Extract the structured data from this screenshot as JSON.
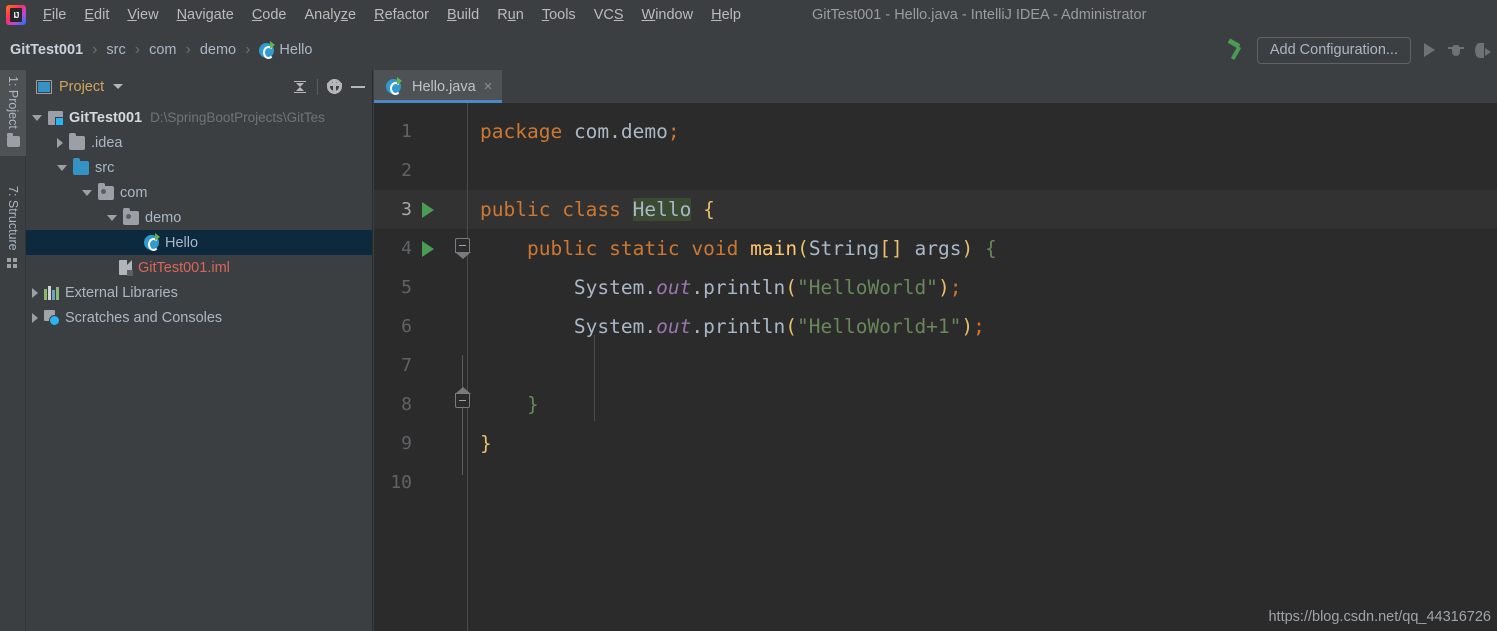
{
  "window": {
    "title": "GitTest001 - Hello.java - IntelliJ IDEA - Administrator",
    "logo_alt": "intellij-idea-logo"
  },
  "menubar": {
    "items": [
      {
        "label": "File",
        "mnemonic": "F"
      },
      {
        "label": "Edit",
        "mnemonic": "E"
      },
      {
        "label": "View",
        "mnemonic": "V"
      },
      {
        "label": "Navigate",
        "mnemonic": "N"
      },
      {
        "label": "Code",
        "mnemonic": "C"
      },
      {
        "label": "Analyze",
        "mnemonic": "z"
      },
      {
        "label": "Refactor",
        "mnemonic": "R"
      },
      {
        "label": "Build",
        "mnemonic": "B"
      },
      {
        "label": "Run",
        "mnemonic": "u"
      },
      {
        "label": "Tools",
        "mnemonic": "T"
      },
      {
        "label": "VCS",
        "mnemonic": "S"
      },
      {
        "label": "Window",
        "mnemonic": "W"
      },
      {
        "label": "Help",
        "mnemonic": "H"
      }
    ]
  },
  "navbar": {
    "breadcrumbs": [
      {
        "label": "GitTest001",
        "icon": null
      },
      {
        "label": "src",
        "icon": null
      },
      {
        "label": "com",
        "icon": null
      },
      {
        "label": "demo",
        "icon": null
      },
      {
        "label": "Hello",
        "icon": "java-class-icon"
      }
    ],
    "separator": "›",
    "build_icon": "hammer-icon",
    "add_configuration_label": "Add Configuration...",
    "run_icon": "run-icon",
    "debug_icon": "debug-icon",
    "coverage_icon": "run-with-coverage-icon"
  },
  "toolstrip": {
    "buttons": [
      {
        "label": "1: Project",
        "icon": "project-folder-icon",
        "active": true
      },
      {
        "label": "7: Structure",
        "icon": "structure-icon",
        "active": false
      }
    ]
  },
  "project_panel": {
    "title": "Project",
    "title_icon": "project-view-icon",
    "dropdown_icon": "chevron-down-icon",
    "actions": [
      {
        "name": "collapse-all-icon"
      },
      {
        "name": "settings-gear-icon"
      },
      {
        "name": "hide-panel-icon"
      }
    ],
    "tree": [
      {
        "label": "GitTest001",
        "suffix": "D:\\SpringBootProjects\\GitTes",
        "indent": 0,
        "twisty": "down",
        "icon": "module-icon",
        "style": "bold",
        "selected": false
      },
      {
        "label": ".idea",
        "suffix": "",
        "indent": 1,
        "twisty": "right",
        "icon": "folder-icon",
        "style": "normal",
        "selected": false
      },
      {
        "label": "src",
        "suffix": "",
        "indent": 1,
        "twisty": "down",
        "icon": "source-folder-icon",
        "style": "normal",
        "selected": false
      },
      {
        "label": "com",
        "suffix": "",
        "indent": 2,
        "twisty": "down",
        "icon": "package-icon",
        "style": "normal",
        "selected": false
      },
      {
        "label": "demo",
        "suffix": "",
        "indent": 3,
        "twisty": "down",
        "icon": "package-icon",
        "style": "normal",
        "selected": false
      },
      {
        "label": "Hello",
        "suffix": "",
        "indent": 4,
        "twisty": "none",
        "icon": "java-class-icon",
        "style": "normal",
        "selected": true
      },
      {
        "label": "GitTest001.iml",
        "suffix": "",
        "indent": 3,
        "twisty": "none",
        "icon": "iml-file-icon",
        "style": "iml",
        "selected": false
      },
      {
        "label": "External Libraries",
        "suffix": "",
        "indent": 0,
        "twisty": "right",
        "icon": "libraries-icon",
        "style": "normal",
        "selected": false
      },
      {
        "label": "Scratches and Consoles",
        "suffix": "",
        "indent": 0,
        "twisty": "right",
        "icon": "scratches-icon",
        "style": "normal",
        "selected": false
      }
    ]
  },
  "editor": {
    "tabs": [
      {
        "label": "Hello.java",
        "icon": "java-class-icon",
        "active": true,
        "close_icon": "×"
      }
    ],
    "current_line": 3,
    "gutter_run_lines": [
      3,
      4
    ],
    "line_numbers": [
      "1",
      "2",
      "3",
      "4",
      "5",
      "6",
      "7",
      "8",
      "9",
      "10"
    ],
    "code_lines": [
      {
        "n": 1,
        "tokens": [
          {
            "t": "package",
            "c": "kw"
          },
          {
            "t": " ",
            "c": "pln"
          },
          {
            "t": "com.demo",
            "c": "pkgn"
          },
          {
            "t": ";",
            "c": "semi"
          }
        ]
      },
      {
        "n": 2,
        "tokens": []
      },
      {
        "n": 3,
        "tokens": [
          {
            "t": "public",
            "c": "kw"
          },
          {
            "t": " ",
            "c": "pln"
          },
          {
            "t": "class",
            "c": "kw"
          },
          {
            "t": " ",
            "c": "pln"
          },
          {
            "t": "Hello",
            "c": "hl"
          },
          {
            "t": " ",
            "c": "pln"
          },
          {
            "t": "{",
            "c": "br-y"
          }
        ]
      },
      {
        "n": 4,
        "tokens": [
          {
            "t": "    ",
            "c": "pln"
          },
          {
            "t": "public",
            "c": "kw"
          },
          {
            "t": " ",
            "c": "pln"
          },
          {
            "t": "static",
            "c": "kw"
          },
          {
            "t": " ",
            "c": "pln"
          },
          {
            "t": "void",
            "c": "kw"
          },
          {
            "t": " ",
            "c": "pln"
          },
          {
            "t": "main",
            "c": "mth"
          },
          {
            "t": "(",
            "c": "br-y"
          },
          {
            "t": "String",
            "c": "pln"
          },
          {
            "t": "[]",
            "c": "br-y"
          },
          {
            "t": " args",
            "c": "pln"
          },
          {
            "t": ")",
            "c": "br-y"
          },
          {
            "t": " ",
            "c": "pln"
          },
          {
            "t": "{",
            "c": "br-g"
          }
        ]
      },
      {
        "n": 5,
        "tokens": [
          {
            "t": "        ",
            "c": "pln"
          },
          {
            "t": "System",
            "c": "pln"
          },
          {
            "t": ".",
            "c": "pln"
          },
          {
            "t": "out",
            "c": "stat"
          },
          {
            "t": ".",
            "c": "pln"
          },
          {
            "t": "println",
            "c": "pln"
          },
          {
            "t": "(",
            "c": "br-y"
          },
          {
            "t": "\"HelloWorld\"",
            "c": "str"
          },
          {
            "t": ")",
            "c": "br-y"
          },
          {
            "t": ";",
            "c": "semi"
          }
        ]
      },
      {
        "n": 6,
        "tokens": [
          {
            "t": "        ",
            "c": "pln"
          },
          {
            "t": "System",
            "c": "pln"
          },
          {
            "t": ".",
            "c": "pln"
          },
          {
            "t": "out",
            "c": "stat"
          },
          {
            "t": ".",
            "c": "pln"
          },
          {
            "t": "println",
            "c": "pln"
          },
          {
            "t": "(",
            "c": "br-y"
          },
          {
            "t": "\"HelloWorld+1\"",
            "c": "str"
          },
          {
            "t": ")",
            "c": "br-y"
          },
          {
            "t": ";",
            "c": "semi"
          }
        ]
      },
      {
        "n": 7,
        "tokens": []
      },
      {
        "n": 8,
        "tokens": [
          {
            "t": "    ",
            "c": "pln"
          },
          {
            "t": "}",
            "c": "br-g"
          }
        ]
      },
      {
        "n": 9,
        "tokens": [
          {
            "t": "}",
            "c": "br-y"
          }
        ]
      },
      {
        "n": 10,
        "tokens": []
      }
    ]
  },
  "watermark": {
    "text": "https://blog.csdn.net/qq_44316726"
  },
  "colors": {
    "chrome": "#3c3f41",
    "editor_bg": "#2b2b2b",
    "current_line": "#323232",
    "selection": "#0d293e",
    "accent": "#4a88c7",
    "keyword": "#cc7832",
    "string": "#6a8759",
    "method": "#ffc66d",
    "static_field": "#9876aa",
    "brace_yellow": "#e8bf6a",
    "run_green": "#499c54"
  }
}
